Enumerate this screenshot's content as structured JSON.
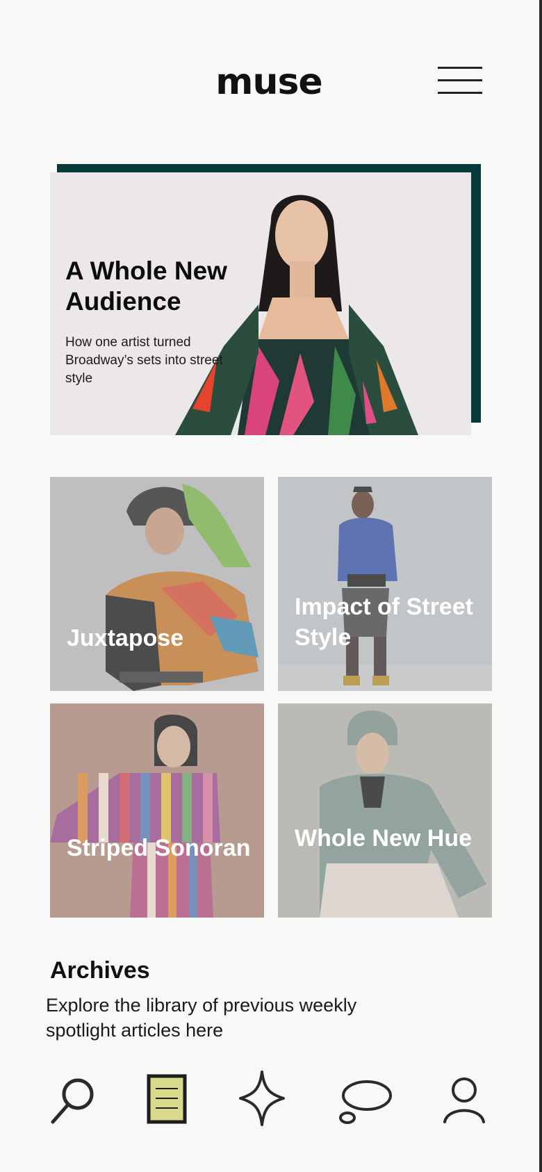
{
  "app": {
    "logo": "muse"
  },
  "header": {
    "menu_icon": "hamburger-menu-icon"
  },
  "hero": {
    "title": "A Whole New Audience",
    "subtitle": "How one artist turned Broadway’s sets into street style",
    "accent_color": "#073b3a"
  },
  "grid": {
    "tiles": [
      {
        "title": "Juxtapose"
      },
      {
        "title": "Impact of Street Style"
      },
      {
        "title": "Striped Sonoran"
      },
      {
        "title": "Whole New Hue"
      }
    ]
  },
  "archives": {
    "title": "Archives",
    "description": "Explore the library of previous weekly spotlight articles here"
  },
  "bottom_nav": {
    "items": [
      {
        "icon": "search-icon",
        "active": false
      },
      {
        "icon": "article-icon",
        "active": true
      },
      {
        "icon": "sparkle-icon",
        "active": false
      },
      {
        "icon": "chat-bubble-icon",
        "active": false
      },
      {
        "icon": "profile-icon",
        "active": false
      }
    ],
    "active_color": "#d8d98a"
  }
}
